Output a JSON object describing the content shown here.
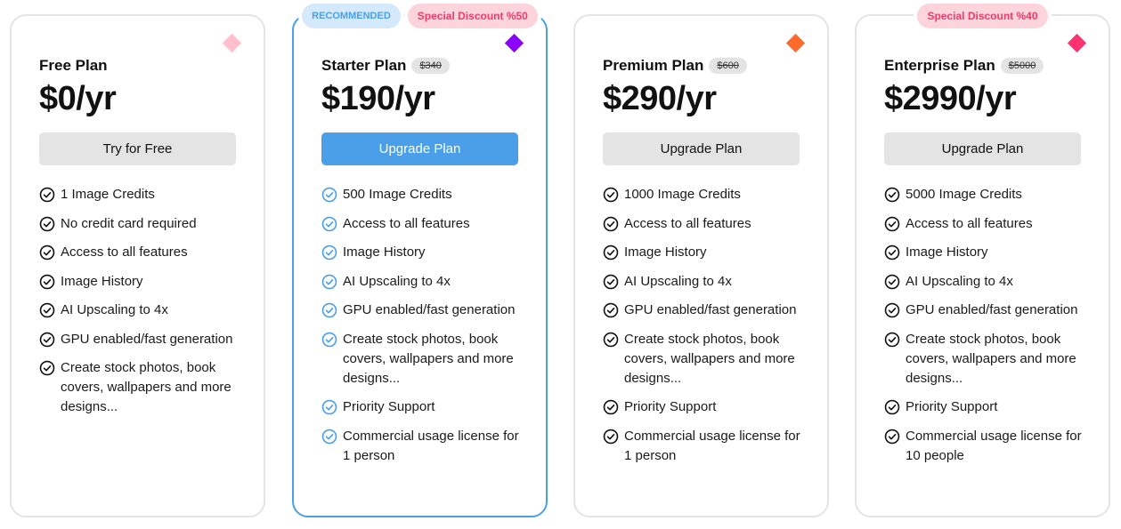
{
  "colors": {
    "accent": "#4a9fe8",
    "discount_text": "#ee3d6b",
    "discount_bg": "#fdd3dc",
    "recommended_bg": "#d4eafc",
    "button_gray": "#e4e4e4"
  },
  "plans": [
    {
      "name": "Free Plan",
      "old_price": null,
      "price": "$0/yr",
      "button": "Try for Free",
      "gem_color": "#ffc0cb",
      "badges": {
        "recommended": null,
        "discount": null
      },
      "features": [
        "1 Image Credits",
        "No credit card required",
        "Access to all features",
        "Image History",
        "AI Upscaling to 4x",
        "GPU enabled/fast generation",
        "Create stock photos, book covers, wallpapers and more designs..."
      ]
    },
    {
      "name": "Starter Plan",
      "old_price": "$340",
      "price": "$190/yr",
      "button": "Upgrade Plan",
      "gem_color": "#8b00ff",
      "badges": {
        "recommended": "RECOMMENDED",
        "discount": "Special Discount %50"
      },
      "features": [
        "500 Image Credits",
        "Access to all features",
        "Image History",
        "AI Upscaling to 4x",
        "GPU enabled/fast generation",
        "Create stock photos, book covers, wallpapers and more designs...",
        "Priority Support",
        "Commercial usage license for 1 person"
      ]
    },
    {
      "name": "Premium Plan",
      "old_price": "$600",
      "price": "$290/yr",
      "button": "Upgrade Plan",
      "gem_color": "#ff6a2b",
      "badges": {
        "recommended": null,
        "discount": null
      },
      "features": [
        "1000 Image Credits",
        "Access to all features",
        "Image History",
        "AI Upscaling to 4x",
        "GPU enabled/fast generation",
        "Create stock photos, book covers, wallpapers and more designs...",
        "Priority Support",
        "Commercial usage license for 1 person"
      ]
    },
    {
      "name": "Enterprise Plan",
      "old_price": "$5000",
      "price": "$2990/yr",
      "button": "Upgrade Plan",
      "gem_color": "#ff3370",
      "badges": {
        "recommended": null,
        "discount": "Special Discount %40"
      },
      "features": [
        "5000 Image Credits",
        "Access to all features",
        "Image History",
        "AI Upscaling to 4x",
        "GPU enabled/fast generation",
        "Create stock photos, book covers, wallpapers and more designs...",
        "Priority Support",
        "Commercial usage license for 10 people"
      ]
    }
  ]
}
